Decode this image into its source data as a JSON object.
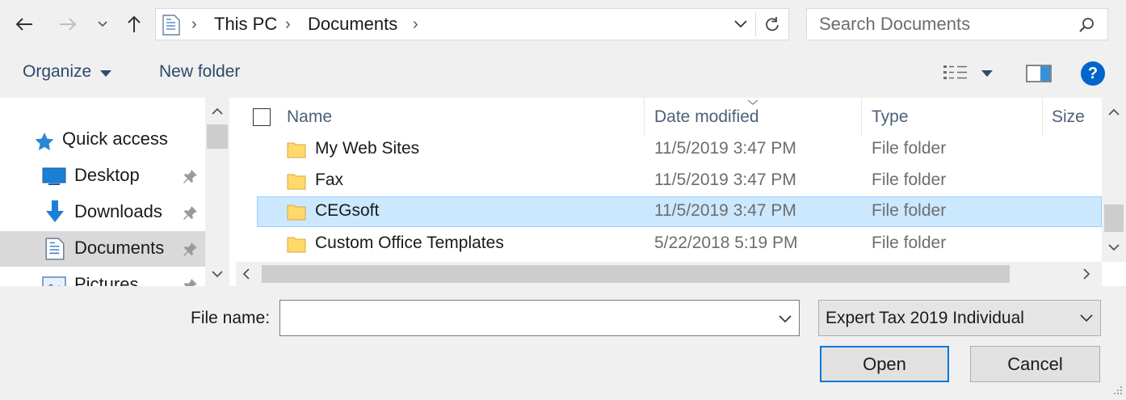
{
  "breadcrumb": {
    "items": [
      "This PC",
      "Documents"
    ]
  },
  "search": {
    "placeholder": "Search Documents"
  },
  "toolbar": {
    "organize": "Organize",
    "new_folder": "New folder"
  },
  "sidebar": {
    "items": [
      {
        "label": "Quick access",
        "icon": "star-icon"
      },
      {
        "label": "Desktop",
        "icon": "desktop-icon",
        "pinned": true
      },
      {
        "label": "Downloads",
        "icon": "download-arrow-icon",
        "pinned": true
      },
      {
        "label": "Documents",
        "icon": "documents-icon",
        "pinned": true,
        "selected": true
      },
      {
        "label": "Pictures",
        "icon": "pictures-icon",
        "pinned": true
      }
    ]
  },
  "file_list": {
    "columns": [
      "Name",
      "Date modified",
      "Type",
      "Size"
    ],
    "rows": [
      {
        "name": "My Web Sites",
        "date": "11/5/2019 3:47 PM",
        "type": "File folder"
      },
      {
        "name": "Fax",
        "date": "11/5/2019 3:47 PM",
        "type": "File folder"
      },
      {
        "name": "CEGsoft",
        "date": "11/5/2019 3:47 PM",
        "type": "File folder",
        "selected": true
      },
      {
        "name": "Custom Office Templates",
        "date": "5/22/2018 5:19 PM",
        "type": "File folder"
      }
    ]
  },
  "footer": {
    "file_name_label": "File name:",
    "file_name_value": "",
    "file_type": "Expert Tax 2019 Individual",
    "open": "Open",
    "cancel": "Cancel"
  },
  "colors": {
    "selection_bg": "#cce8ff",
    "selection_border": "#99d1ff",
    "accent": "#0078d7",
    "help_icon": "#0066cc"
  }
}
